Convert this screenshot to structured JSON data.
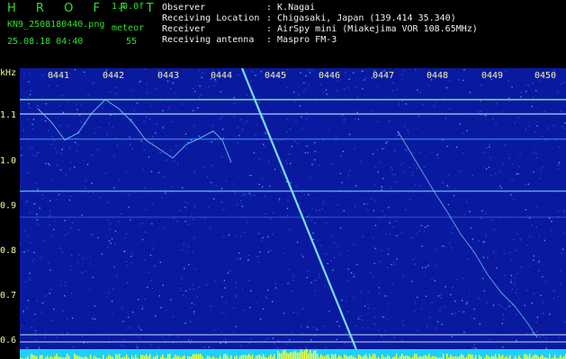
{
  "header": {
    "app_title": "H R O F F T",
    "version": "1.0.0f",
    "filename": "KN9_2508180440.png",
    "datetime": "25.08.18 04:40",
    "meteor_label": "meteor",
    "meteor_count": "55",
    "info": [
      {
        "label": "Observer",
        "value": ": K.Nagai"
      },
      {
        "label": "Receiving Location",
        "value": ": Chigasaki, Japan (139.414 35.340)"
      },
      {
        "label": "Receiver",
        "value": ": AirSpy mini (Miakejima VOR 108.65MHz)"
      },
      {
        "label": "Receiving antenna",
        "value": ": Maspro FM-3"
      }
    ]
  },
  "axes": {
    "y_unit": "kHz",
    "y_ticks": [
      "1.1",
      "1.0",
      "0.9",
      "0.8",
      "0.7",
      "0.6"
    ],
    "x_ticks": [
      "0441",
      "0442",
      "0443",
      "0444",
      "0445",
      "0446",
      "0447",
      "0448",
      "0449",
      "0450"
    ]
  },
  "colors": {
    "background_noise": "#0a1aa0",
    "signal": "#40e0ff",
    "text_green": "#2ee12e",
    "text_yellow": "#f2f2a0",
    "bottom_bar": "#ffff00"
  }
}
